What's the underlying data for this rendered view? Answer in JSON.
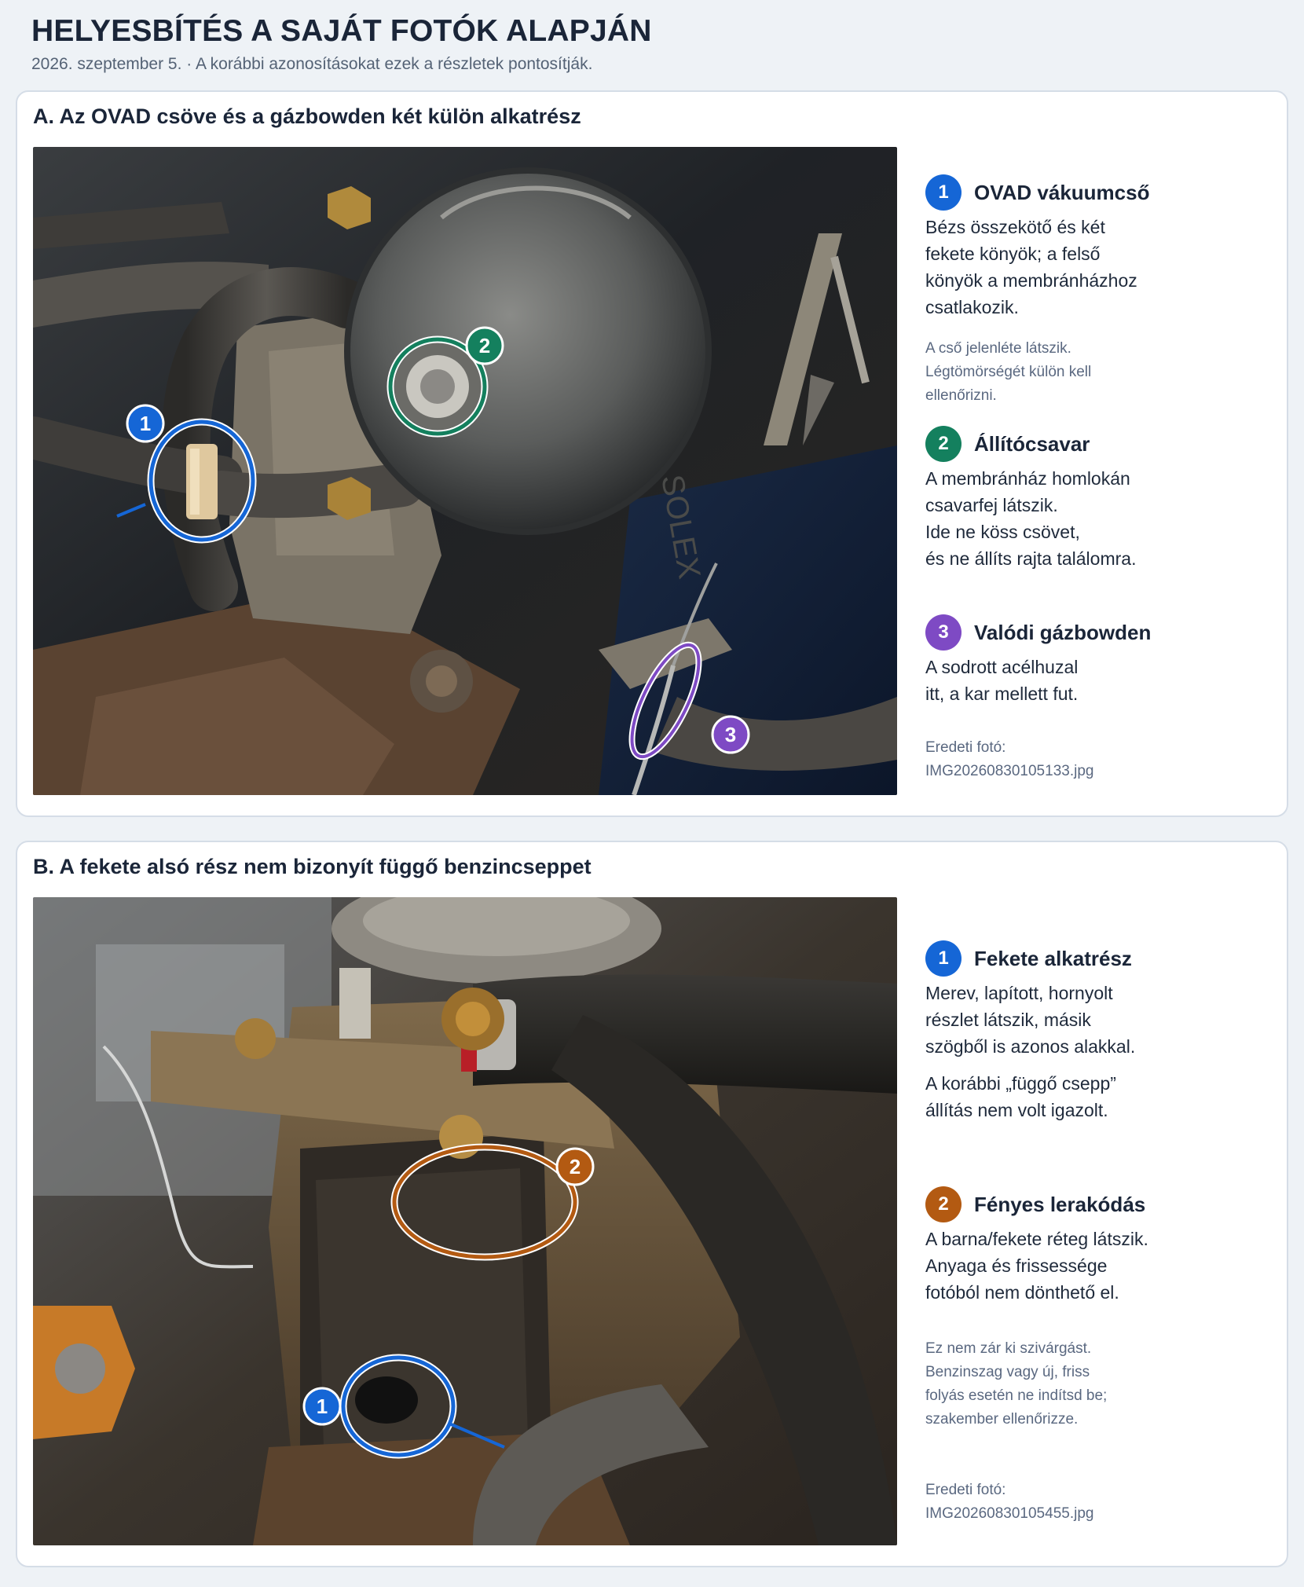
{
  "header": {
    "title": "HELYESBÍTÉS A SAJÁT FOTÓK ALAPJÁN",
    "subtitle": "2026. szeptember 5. · A korábbi azonosításokat ezek a részletek pontosítják."
  },
  "section_a": {
    "title": "A. Az OVAD csöve és a gázbowden két külön alkatrész",
    "markers": [
      "1",
      "2",
      "3"
    ],
    "annotations": [
      {
        "number": "1",
        "title": "OVAD vákuumcső",
        "body": [
          "Bézs összekötő és két",
          "fekete könyök; a felső",
          "könyök a membránházhoz",
          "csatlakozik."
        ],
        "note": [
          "A cső jelenléte látszik.",
          "Légtömörségét külön kell",
          "ellenőrizni."
        ],
        "color": "#1566d6"
      },
      {
        "number": "2",
        "title": "Állítócsavar",
        "body": [
          "A membránház homlokán",
          "csavarfej látszik.",
          "Ide ne köss csövet,",
          "és ne állíts rajta találomra."
        ],
        "color": "#14805e"
      },
      {
        "number": "3",
        "title": "Valódi gázbowden",
        "body": [
          "A sodrott acélhuzal",
          "itt, a kar mellett fut."
        ],
        "color": "#7e4ac4"
      }
    ],
    "source_label": "Eredeti fotó:",
    "source_file": "IMG20260830105133.jpg"
  },
  "section_b": {
    "title": "B. A fekete alsó rész nem bizonyít függő benzincseppet",
    "markers": [
      "1",
      "2"
    ],
    "annotations": [
      {
        "number": "1",
        "title": "Fekete alkatrész",
        "body": [
          "Merev, lapított, hornyolt",
          "részlet látszik, másik",
          "szögből is azonos alakkal."
        ],
        "body2": [
          "A korábbi „függő csepp”",
          "állítás nem volt igazolt."
        ],
        "color": "#1566d6"
      },
      {
        "number": "2",
        "title": "Fényes lerakódás",
        "body": [
          "A barna/fekete réteg látszik.",
          "Anyaga és frissessége",
          "fotóból nem dönthető el."
        ],
        "color": "#b35a12"
      }
    ],
    "warning": [
      "Ez nem zár ki szivárgást.",
      "Benzinszag vagy új, friss",
      "folyás esetén ne indítsd be;",
      "szakember ellenőrizze."
    ],
    "source_label": "Eredeti fotó:",
    "source_file": "IMG20260830105455.jpg"
  }
}
